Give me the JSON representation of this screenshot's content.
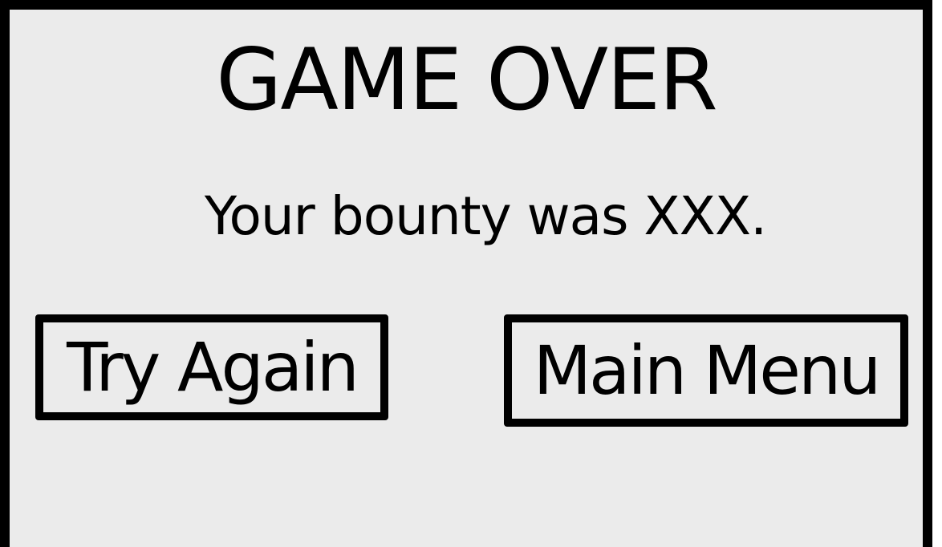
{
  "screen": {
    "title": "GAME OVER",
    "message": "Your bounty was XXX."
  },
  "buttons": {
    "try_again": "Try Again",
    "main_menu": "Main Menu"
  },
  "colors": {
    "background": "#ebebeb",
    "ink": "#000000"
  }
}
